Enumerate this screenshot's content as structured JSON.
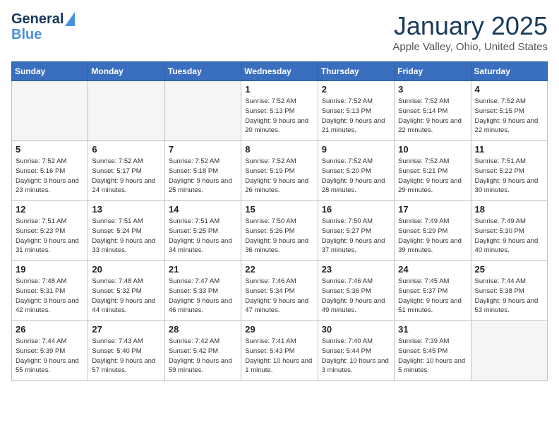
{
  "logo": {
    "line1": "General",
    "line2": "Blue"
  },
  "title": "January 2025",
  "location": "Apple Valley, Ohio, United States",
  "days_of_week": [
    "Sunday",
    "Monday",
    "Tuesday",
    "Wednesday",
    "Thursday",
    "Friday",
    "Saturday"
  ],
  "weeks": [
    [
      {
        "day": "",
        "sunrise": "",
        "sunset": "",
        "daylight": "",
        "empty": true
      },
      {
        "day": "",
        "sunrise": "",
        "sunset": "",
        "daylight": "",
        "empty": true
      },
      {
        "day": "",
        "sunrise": "",
        "sunset": "",
        "daylight": "",
        "empty": true
      },
      {
        "day": "1",
        "sunrise": "Sunrise: 7:52 AM",
        "sunset": "Sunset: 5:13 PM",
        "daylight": "Daylight: 9 hours and 20 minutes."
      },
      {
        "day": "2",
        "sunrise": "Sunrise: 7:52 AM",
        "sunset": "Sunset: 5:13 PM",
        "daylight": "Daylight: 9 hours and 21 minutes."
      },
      {
        "day": "3",
        "sunrise": "Sunrise: 7:52 AM",
        "sunset": "Sunset: 5:14 PM",
        "daylight": "Daylight: 9 hours and 22 minutes."
      },
      {
        "day": "4",
        "sunrise": "Sunrise: 7:52 AM",
        "sunset": "Sunset: 5:15 PM",
        "daylight": "Daylight: 9 hours and 22 minutes."
      }
    ],
    [
      {
        "day": "5",
        "sunrise": "Sunrise: 7:52 AM",
        "sunset": "Sunset: 5:16 PM",
        "daylight": "Daylight: 9 hours and 23 minutes."
      },
      {
        "day": "6",
        "sunrise": "Sunrise: 7:52 AM",
        "sunset": "Sunset: 5:17 PM",
        "daylight": "Daylight: 9 hours and 24 minutes."
      },
      {
        "day": "7",
        "sunrise": "Sunrise: 7:52 AM",
        "sunset": "Sunset: 5:18 PM",
        "daylight": "Daylight: 9 hours and 25 minutes."
      },
      {
        "day": "8",
        "sunrise": "Sunrise: 7:52 AM",
        "sunset": "Sunset: 5:19 PM",
        "daylight": "Daylight: 9 hours and 26 minutes."
      },
      {
        "day": "9",
        "sunrise": "Sunrise: 7:52 AM",
        "sunset": "Sunset: 5:20 PM",
        "daylight": "Daylight: 9 hours and 28 minutes."
      },
      {
        "day": "10",
        "sunrise": "Sunrise: 7:52 AM",
        "sunset": "Sunset: 5:21 PM",
        "daylight": "Daylight: 9 hours and 29 minutes."
      },
      {
        "day": "11",
        "sunrise": "Sunrise: 7:51 AM",
        "sunset": "Sunset: 5:22 PM",
        "daylight": "Daylight: 9 hours and 30 minutes."
      }
    ],
    [
      {
        "day": "12",
        "sunrise": "Sunrise: 7:51 AM",
        "sunset": "Sunset: 5:23 PM",
        "daylight": "Daylight: 9 hours and 31 minutes."
      },
      {
        "day": "13",
        "sunrise": "Sunrise: 7:51 AM",
        "sunset": "Sunset: 5:24 PM",
        "daylight": "Daylight: 9 hours and 33 minutes."
      },
      {
        "day": "14",
        "sunrise": "Sunrise: 7:51 AM",
        "sunset": "Sunset: 5:25 PM",
        "daylight": "Daylight: 9 hours and 34 minutes."
      },
      {
        "day": "15",
        "sunrise": "Sunrise: 7:50 AM",
        "sunset": "Sunset: 5:26 PM",
        "daylight": "Daylight: 9 hours and 36 minutes."
      },
      {
        "day": "16",
        "sunrise": "Sunrise: 7:50 AM",
        "sunset": "Sunset: 5:27 PM",
        "daylight": "Daylight: 9 hours and 37 minutes."
      },
      {
        "day": "17",
        "sunrise": "Sunrise: 7:49 AM",
        "sunset": "Sunset: 5:29 PM",
        "daylight": "Daylight: 9 hours and 39 minutes."
      },
      {
        "day": "18",
        "sunrise": "Sunrise: 7:49 AM",
        "sunset": "Sunset: 5:30 PM",
        "daylight": "Daylight: 9 hours and 40 minutes."
      }
    ],
    [
      {
        "day": "19",
        "sunrise": "Sunrise: 7:48 AM",
        "sunset": "Sunset: 5:31 PM",
        "daylight": "Daylight: 9 hours and 42 minutes."
      },
      {
        "day": "20",
        "sunrise": "Sunrise: 7:48 AM",
        "sunset": "Sunset: 5:32 PM",
        "daylight": "Daylight: 9 hours and 44 minutes."
      },
      {
        "day": "21",
        "sunrise": "Sunrise: 7:47 AM",
        "sunset": "Sunset: 5:33 PM",
        "daylight": "Daylight: 9 hours and 46 minutes."
      },
      {
        "day": "22",
        "sunrise": "Sunrise: 7:46 AM",
        "sunset": "Sunset: 5:34 PM",
        "daylight": "Daylight: 9 hours and 47 minutes."
      },
      {
        "day": "23",
        "sunrise": "Sunrise: 7:46 AM",
        "sunset": "Sunset: 5:36 PM",
        "daylight": "Daylight: 9 hours and 49 minutes."
      },
      {
        "day": "24",
        "sunrise": "Sunrise: 7:45 AM",
        "sunset": "Sunset: 5:37 PM",
        "daylight": "Daylight: 9 hours and 51 minutes."
      },
      {
        "day": "25",
        "sunrise": "Sunrise: 7:44 AM",
        "sunset": "Sunset: 5:38 PM",
        "daylight": "Daylight: 9 hours and 53 minutes."
      }
    ],
    [
      {
        "day": "26",
        "sunrise": "Sunrise: 7:44 AM",
        "sunset": "Sunset: 5:39 PM",
        "daylight": "Daylight: 9 hours and 55 minutes."
      },
      {
        "day": "27",
        "sunrise": "Sunrise: 7:43 AM",
        "sunset": "Sunset: 5:40 PM",
        "daylight": "Daylight: 9 hours and 57 minutes."
      },
      {
        "day": "28",
        "sunrise": "Sunrise: 7:42 AM",
        "sunset": "Sunset: 5:42 PM",
        "daylight": "Daylight: 9 hours and 59 minutes."
      },
      {
        "day": "29",
        "sunrise": "Sunrise: 7:41 AM",
        "sunset": "Sunset: 5:43 PM",
        "daylight": "Daylight: 10 hours and 1 minute."
      },
      {
        "day": "30",
        "sunrise": "Sunrise: 7:40 AM",
        "sunset": "Sunset: 5:44 PM",
        "daylight": "Daylight: 10 hours and 3 minutes."
      },
      {
        "day": "31",
        "sunrise": "Sunrise: 7:39 AM",
        "sunset": "Sunset: 5:45 PM",
        "daylight": "Daylight: 10 hours and 5 minutes."
      },
      {
        "day": "",
        "sunrise": "",
        "sunset": "",
        "daylight": "",
        "empty": true
      }
    ]
  ]
}
